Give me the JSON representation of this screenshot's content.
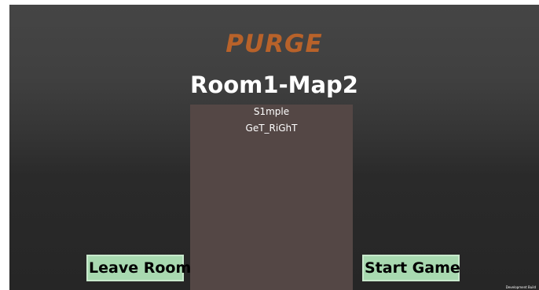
{
  "game": {
    "title": "PURGE"
  },
  "room": {
    "name": "Room1-Map2"
  },
  "players": [
    {
      "name": "S1mple"
    },
    {
      "name": "GeT_RiGhT"
    }
  ],
  "buttons": {
    "leave_room": "Leave Room",
    "start_game": "Start Game"
  },
  "overlay": {
    "development_build": "Development Build"
  },
  "colors": {
    "title_accent": "#b8622a",
    "button_bg": "#a8d9b0",
    "player_panel_bg": "#544745",
    "background_top": "#454545",
    "background_bottom": "#262626"
  }
}
